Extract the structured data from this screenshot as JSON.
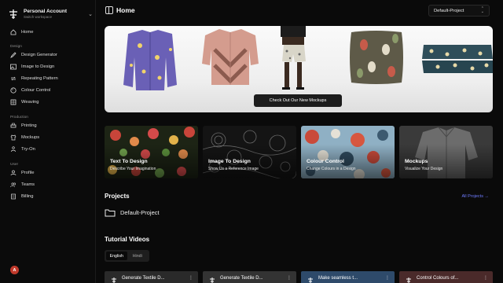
{
  "account": {
    "name": "Personal Account",
    "subtitle": "Switch workspace"
  },
  "nav": {
    "home": "Home",
    "design_section": "Design",
    "design_generator": "Design Generator",
    "image_to_design": "Image to Design",
    "repeating_pattern": "Repeating Pattern",
    "colour_control": "Colour Control",
    "weaving": "Weaving",
    "production_section": "Production",
    "printing": "Printing",
    "mockups": "Mockups",
    "try_on": "Try-On",
    "user_section": "User",
    "profile": "Profile",
    "teams": "Teams",
    "billing": "Billing",
    "avatar_initial": "A"
  },
  "header": {
    "title": "Home",
    "project": "Default-Project"
  },
  "hero": {
    "button": "Check Out Our New Mockups"
  },
  "features": [
    {
      "title": "Text To Design",
      "subtitle": "Describe Your Imagination"
    },
    {
      "title": "Image To Design",
      "subtitle": "Show Us a Reference Image"
    },
    {
      "title": "Colour Control",
      "subtitle": "Change Colours in a Design"
    },
    {
      "title": "Mockups",
      "subtitle": "Visualize Your Design"
    }
  ],
  "projects": {
    "title": "Projects",
    "all_link": "All Projects →",
    "items": [
      "Default-Project"
    ]
  },
  "tutorials": {
    "title": "Tutorial Videos",
    "tabs": [
      "English",
      "Hindi"
    ],
    "videos": [
      "Generate Textile D...",
      "Generate Textile D...",
      "Make seamless t...",
      "Control Colours of..."
    ]
  },
  "colors": {
    "accent_link": "#6f7cff",
    "avatar": "#c0392b",
    "background": "#0a0a0a"
  }
}
